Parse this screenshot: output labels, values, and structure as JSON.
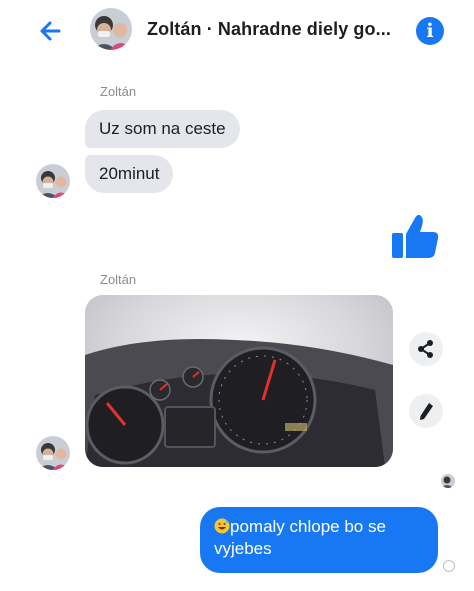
{
  "header": {
    "title": "Zoltán · Nahradne diely go...",
    "back_icon": "arrow-left-icon",
    "info_icon": "info-icon",
    "info_glyph": "i"
  },
  "messages": {
    "group1_sender": "Zoltán",
    "msg1": "Uz som na ceste",
    "msg2": "20minut",
    "group2_sender": "Zoltán",
    "outgoing": "pomaly chlope bo se vyjebes"
  },
  "photo_actions": {
    "share_icon": "share-icon",
    "edit_icon": "pencil-icon"
  },
  "colors": {
    "accent": "#1877f2",
    "bubble_in": "#e4e6eb",
    "text_secondary": "#8a8d91"
  }
}
